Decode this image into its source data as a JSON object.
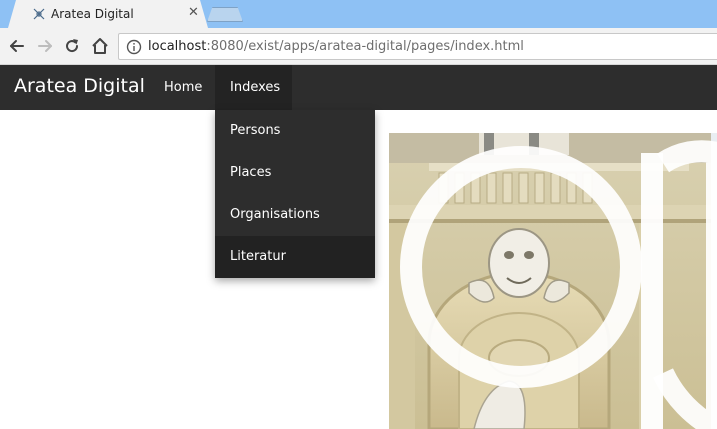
{
  "browser": {
    "tab": {
      "title": "Aratea Digital",
      "close_glyph": "✕",
      "favicon": "aratea-favicon-icon"
    },
    "address_bar": {
      "host": "localhost",
      "rest": ":8080/exist/apps/aratea-digital/pages/index.html",
      "info_icon": "info-icon"
    },
    "nav_icons": [
      "back-arrow-icon",
      "forward-arrow-icon",
      "reload-icon",
      "home-icon"
    ]
  },
  "site": {
    "brand": "Aratea Digital",
    "nav": {
      "home_label": "Home",
      "indexes_label": "Indexes"
    },
    "dropdown": {
      "items": [
        {
          "label": "Persons"
        },
        {
          "label": "Places"
        },
        {
          "label": "Organisations"
        },
        {
          "label": "Literatur",
          "highlighted": true
        }
      ]
    },
    "colors": {
      "navbar": "#2d2d2d",
      "navbar_active": "#232323",
      "dropdown_hover": "#222222",
      "tabstrip": "#8ec1f4"
    }
  }
}
